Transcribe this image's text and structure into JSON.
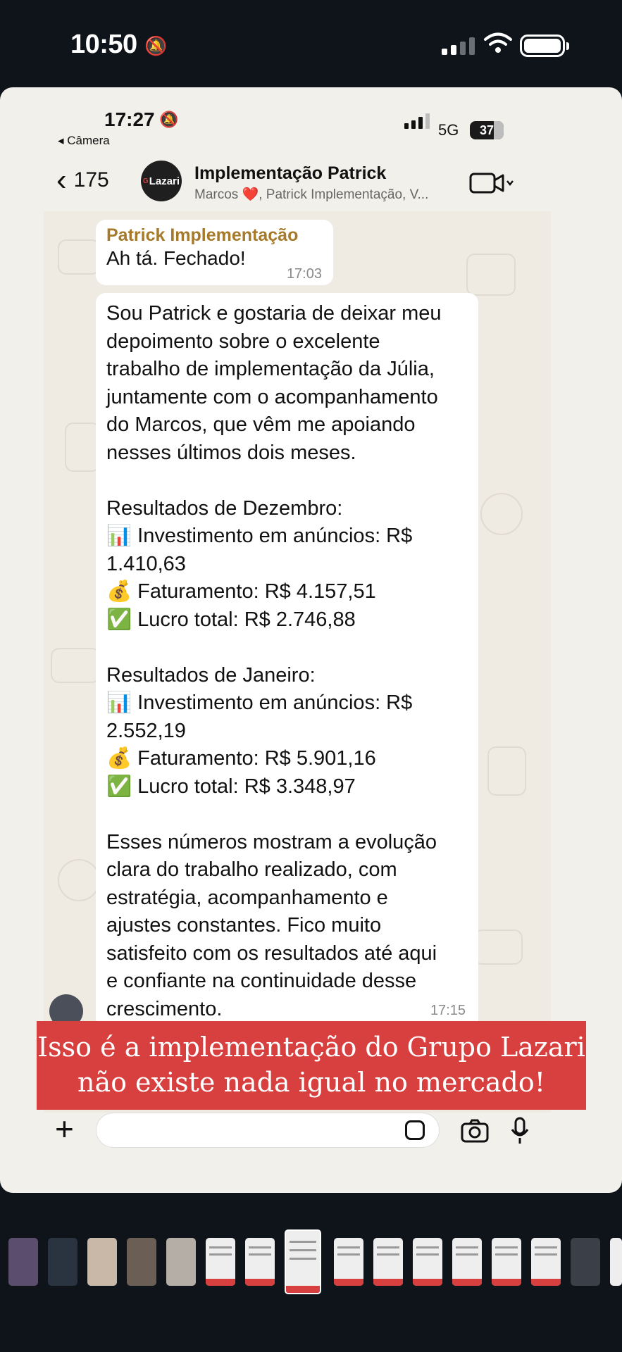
{
  "outer_status": {
    "time": "10:50"
  },
  "inner_status": {
    "time": "17:27",
    "back_app": "◂ Câmera",
    "network": "5G",
    "battery": "37"
  },
  "header": {
    "unread_count": "175",
    "avatar_text": "Lazari",
    "title": "Implementação Patrick",
    "members": "Marcos ❤️, Patrick Implementação, V..."
  },
  "messages": [
    {
      "sender": "Patrick Implementação",
      "text": "Ah tá. Fechado!",
      "time": "17:03"
    },
    {
      "lines": [
        "Sou Patrick e gostaria de deixar meu",
        "depoimento sobre o excelente",
        "trabalho de implementação da Júlia,",
        "juntamente com o acompanhamento",
        "do Marcos, que vêm me apoiando",
        "nesses últimos dois meses.",
        "",
        "Resultados de Dezembro:",
        "📊 Investimento em anúncios: R$",
        "1.410,63",
        "💰 Faturamento: R$ 4.157,51",
        "✅ Lucro total: R$ 2.746,88",
        "",
        "Resultados de Janeiro:",
        "📊 Investimento em anúncios: R$",
        "2.552,19",
        "💰 Faturamento: R$ 5.901,16",
        "✅ Lucro total: R$ 3.348,97",
        "",
        "Esses números mostram a evolução",
        "clara do trabalho realizado, com",
        "estratégia, acompanhamento e",
        "ajustes constantes. Fico muito",
        "satisfeito com os resultados até aqui",
        "e confiante na continuidade desse",
        "crescimento."
      ],
      "time": "17:15"
    }
  ],
  "banner": {
    "line1": "Isso é a implementação do Grupo Lazari",
    "line2": "não existe nada igual no mercado!"
  },
  "colors": {
    "banner": "#d8403f",
    "sender": "#a57a2a",
    "chat_bg": "#efeae2"
  }
}
